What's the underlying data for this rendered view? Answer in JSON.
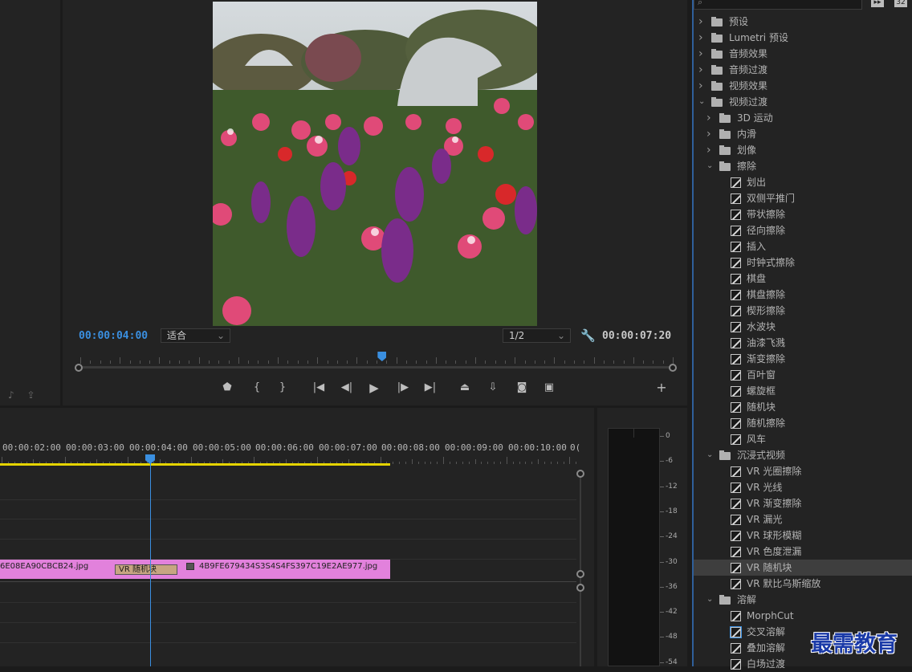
{
  "program_monitor": {
    "current_timecode": "00:00:04:00",
    "duration_timecode": "00:00:07:20",
    "zoom_value": "适合",
    "resolution_value": "1/2",
    "playhead_fraction": 0.51
  },
  "transport_icons": [
    "marker-icon",
    "mark-in-icon",
    "mark-out-icon",
    "go-to-in-icon",
    "step-back-icon",
    "play-icon",
    "step-forward-icon",
    "go-to-out-icon",
    "lift-icon",
    "extract-icon",
    "export-frame-icon",
    "compare-icon",
    "add-button-icon"
  ],
  "timeline": {
    "ruler_labels": [
      "00:00:02:00",
      "00:00:03:00",
      "00:00:04:00",
      "00:00:05:00",
      "00:00:06:00",
      "00:00:07:00",
      "00:00:08:00",
      "00:00:09:00",
      "00:00:10:00",
      "0("
    ],
    "clip_a_name": "6E08EA90CBCB24.jpg",
    "clip_b_name": "4B9FE679434S3S4S4FS397C19E2AE977.jpg",
    "transition_label": "VR 随机块"
  },
  "audio_meter": {
    "scale": [
      "0",
      "-6",
      "-12",
      "-18",
      "-24",
      "-30",
      "-36",
      "-42",
      "-48",
      "-54"
    ]
  },
  "effects_panel": {
    "rows": [
      {
        "kind": "folder",
        "level": 0,
        "open": false,
        "label": "预设"
      },
      {
        "kind": "folder",
        "level": 0,
        "open": false,
        "label": "Lumetri 预设"
      },
      {
        "kind": "folder",
        "level": 0,
        "open": false,
        "label": "音频效果"
      },
      {
        "kind": "folder",
        "level": 0,
        "open": false,
        "label": "音频过渡"
      },
      {
        "kind": "folder",
        "level": 0,
        "open": false,
        "label": "视频效果"
      },
      {
        "kind": "folder",
        "level": 0,
        "open": true,
        "label": "视频过渡"
      },
      {
        "kind": "folder",
        "level": 1,
        "open": false,
        "label": "3D 运动"
      },
      {
        "kind": "folder",
        "level": 1,
        "open": false,
        "label": "内滑"
      },
      {
        "kind": "folder",
        "level": 1,
        "open": false,
        "label": "划像"
      },
      {
        "kind": "folder",
        "level": 1,
        "open": true,
        "label": "擦除"
      },
      {
        "kind": "effect",
        "label": "划出"
      },
      {
        "kind": "effect",
        "label": "双侧平推门"
      },
      {
        "kind": "effect",
        "label": "带状擦除"
      },
      {
        "kind": "effect",
        "label": "径向擦除"
      },
      {
        "kind": "effect",
        "label": "插入"
      },
      {
        "kind": "effect",
        "label": "时钟式擦除"
      },
      {
        "kind": "effect",
        "label": "棋盘"
      },
      {
        "kind": "effect",
        "label": "棋盘擦除"
      },
      {
        "kind": "effect",
        "label": "楔形擦除"
      },
      {
        "kind": "effect",
        "label": "水波块"
      },
      {
        "kind": "effect",
        "label": "油漆飞溅"
      },
      {
        "kind": "effect",
        "label": "渐变擦除"
      },
      {
        "kind": "effect",
        "label": "百叶窗"
      },
      {
        "kind": "effect",
        "label": "螺旋框"
      },
      {
        "kind": "effect",
        "label": "随机块"
      },
      {
        "kind": "effect",
        "label": "随机擦除"
      },
      {
        "kind": "effect",
        "label": "风车"
      },
      {
        "kind": "folder",
        "level": 1,
        "open": true,
        "label": "沉浸式视频"
      },
      {
        "kind": "effect",
        "label": "VR 光圈擦除"
      },
      {
        "kind": "effect",
        "label": "VR 光线"
      },
      {
        "kind": "effect",
        "label": "VR 渐变擦除"
      },
      {
        "kind": "effect",
        "label": "VR 漏光"
      },
      {
        "kind": "effect",
        "label": "VR 球形模糊"
      },
      {
        "kind": "effect",
        "label": "VR 色度泄漏"
      },
      {
        "kind": "effect",
        "label": "VR 随机块",
        "selected": true
      },
      {
        "kind": "effect",
        "label": "VR 默比乌斯缩放"
      },
      {
        "kind": "folder",
        "level": 1,
        "open": true,
        "label": "溶解"
      },
      {
        "kind": "effect",
        "label": "MorphCut"
      },
      {
        "kind": "effect",
        "label": "交叉溶解",
        "focus": true
      },
      {
        "kind": "effect",
        "label": "叠加溶解"
      },
      {
        "kind": "effect",
        "label": "白场过渡"
      }
    ]
  },
  "watermark": "最需教育"
}
